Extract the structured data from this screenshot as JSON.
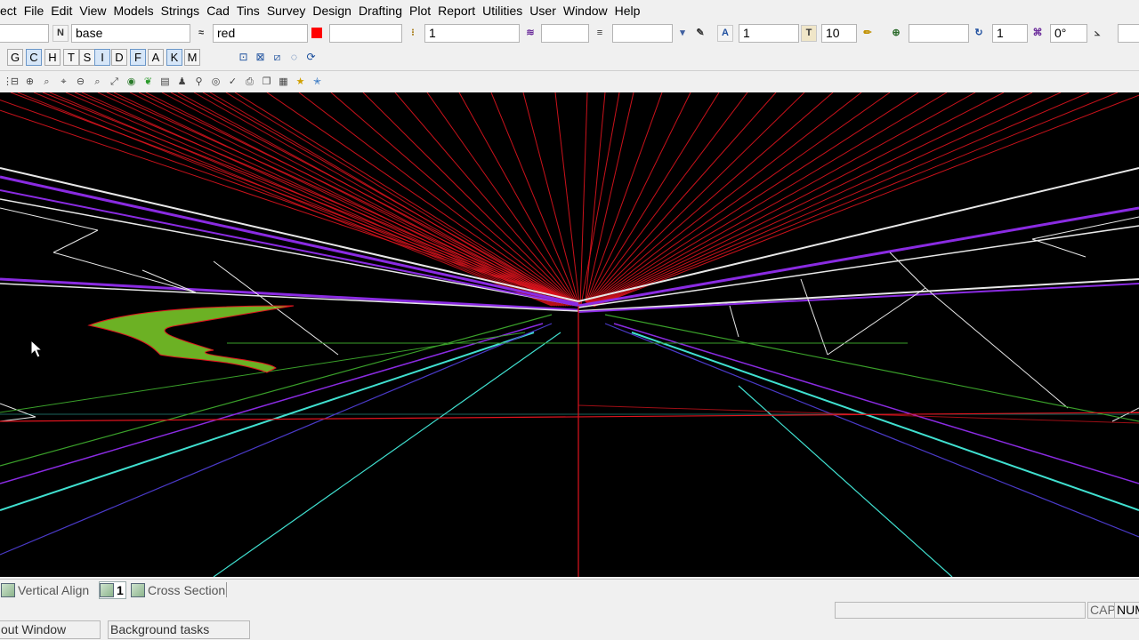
{
  "menu": [
    "ect",
    "File",
    "Edit",
    "View",
    "Models",
    "Strings",
    "Cad",
    "Tins",
    "Survey",
    "Design",
    "Drafting",
    "Plot",
    "Report",
    "Utilities",
    "User",
    "Window",
    "Help"
  ],
  "toolbar": {
    "model_name": "base",
    "colour_name": "red",
    "colour_swatch": "#ff0000",
    "weight_value": "1",
    "text_size_value": "1",
    "text_height_value": "10",
    "factor_value": "1",
    "angle_value": "0°",
    "n_label": "N",
    "t_label": "T"
  },
  "layer_buttons": [
    "G",
    "C",
    "H",
    "T",
    "S",
    "I",
    "D",
    "F",
    "A",
    "K",
    "M"
  ],
  "tabs": {
    "vertical_align": "Vertical Align",
    "active_number": "1",
    "cross_section": "Cross Section"
  },
  "status": {
    "cap": "CAP",
    "num": "NUM"
  },
  "taskbar": {
    "output_window": "out Window",
    "background_tasks": "Background tasks"
  },
  "colors": {
    "viewport_bg": "#000000",
    "red_lines": "#e0141e",
    "white_lines": "#e8e8e8",
    "purple_lines": "#8a2be2",
    "cyan_lines": "#40e0d0",
    "green_lines": "#3aa02a"
  }
}
